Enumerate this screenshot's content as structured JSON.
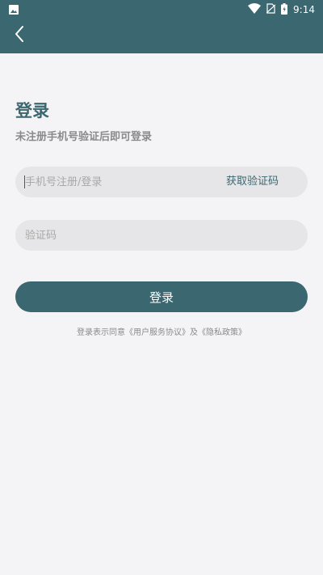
{
  "colors": {
    "header": "#3b6770",
    "accent": "#3b6770",
    "background": "#f4f4f6",
    "field_background": "#e6e6e8"
  },
  "status_bar": {
    "time": "9:14",
    "icons": [
      "image-icon",
      "wifi-icon",
      "no-sim-icon",
      "battery-icon"
    ]
  },
  "header": {
    "back_icon": "chevron-left-icon"
  },
  "login": {
    "title": "登录",
    "subtitle": "未注册手机号验证后即可登录",
    "phone_placeholder": "手机号注册/登录",
    "get_code_label": "获取验证码",
    "code_placeholder": "验证码",
    "submit_label": "登录"
  },
  "agreement": {
    "prefix": "登录表示同意",
    "user_agreement": "《用户服务协议》",
    "conjunction": "及",
    "privacy_policy": "《隐私政策》"
  }
}
